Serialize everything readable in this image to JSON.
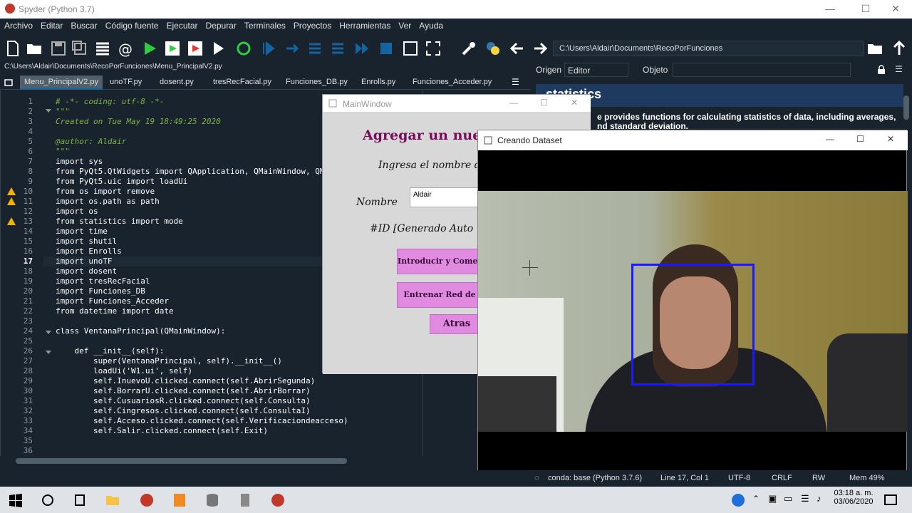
{
  "window": {
    "title": "Spyder (Python 3.7)"
  },
  "menu": [
    "Archivo",
    "Editar",
    "Buscar",
    "Código fuente",
    "Ejecutar",
    "Depurar",
    "Terminales",
    "Proyectos",
    "Herramientas",
    "Ver",
    "Ayuda"
  ],
  "toolbar": {
    "cwd_path": "C:\\Users\\Aldair\\Documents\\RecoPorFunciones"
  },
  "editor": {
    "file_path": "C:\\Users\\Aldair\\Documents\\RecoPorFunciones\\Menu_PrincipalV2.py",
    "tabs": [
      "Menu_PrincipalV2.py",
      "unoTF.py",
      "dosent.py",
      "tresRecFacial.py",
      "Funciones_DB.py",
      "Enrolls.py",
      "Funciones_Acceder.py"
    ],
    "line_numbers": [
      "1",
      "2",
      "3",
      "4",
      "5",
      "6",
      "7",
      "8",
      "9",
      "10",
      "11",
      "12",
      "13",
      "14",
      "15",
      "16",
      "17",
      "18",
      "19",
      "20",
      "21",
      "22",
      "23",
      "24",
      "25",
      "26",
      "27",
      "28",
      "29",
      "30",
      "31",
      "32",
      "33",
      "34",
      "35",
      "36"
    ],
    "lines": [
      "# -*- coding: utf-8 -*-",
      "\"\"\"",
      "Created on Tue May 19 18:49:25 2020",
      "",
      "@author: Aldair",
      "\"\"\"",
      "import sys",
      "from PyQt5.QtWidgets import QApplication, QMainWindow, QM",
      "from PyQt5.uic import loadUi",
      "from os import remove",
      "import os.path as path",
      "import os",
      "from statistics import mode",
      "import time",
      "import shutil",
      "import Enrolls",
      "import unoTF",
      "import dosent",
      "import tresRecFacial",
      "import Funciones_DB",
      "import Funciones_Acceder",
      "from datetime import date",
      "",
      "class VentanaPrincipal(QMainWindow):",
      "",
      "    def __init__(self):",
      "        super(VentanaPrincipal, self).__init__()",
      "        loadUi('W1.ui', self)",
      "        self.InuevoU.clicked.connect(self.AbrirSegunda)",
      "        self.BorrarU.clicked.connect(self.AbrirBorrar)",
      "        self.CusuariosR.clicked.connect(self.Consulta)",
      "        self.Cingresos.clicked.connect(self.ConsultaI)",
      "        self.Acceso.clicked.connect(self.Verificaciondeacceso)",
      "        self.Salir.clicked.connect(self.Exit)",
      "",
      ""
    ]
  },
  "help_pane": {
    "origen_label": "Origen",
    "origen_value": "Editor",
    "objeto_label": "Objeto",
    "title": "statistics",
    "text_line1": "e provides functions for calculating statistics of data, including averages,",
    "text_line2": "nd standard deviation."
  },
  "status": {
    "conda": "conda: base (Python 3.7.6)",
    "position": "Line 17, Col 1",
    "encoding": "UTF-8",
    "eol": "CRLF",
    "perm": "RW",
    "mem": "Mem 49%"
  },
  "taskbar": {
    "time": "03:18 a. m.",
    "date": "03/06/2020"
  },
  "main_window": {
    "title": "MainWindow",
    "heading": "Agregar un nuevo",
    "prompt": "Ingresa el nombre d",
    "name_label": "Nombre",
    "name_value": "Aldair",
    "id_label": "#ID  [Generado Auto",
    "btn_start": "Introducir y Comenzar",
    "btn_train": "Entrenar Red de",
    "btn_back": "Atras"
  },
  "camera_window": {
    "title": "Creando Dataset"
  },
  "colors": {
    "accent": "#1464a0",
    "face_box": "#1a1aff",
    "dialog_heading": "#7a0b5c",
    "button_pink": "#e08be0"
  }
}
